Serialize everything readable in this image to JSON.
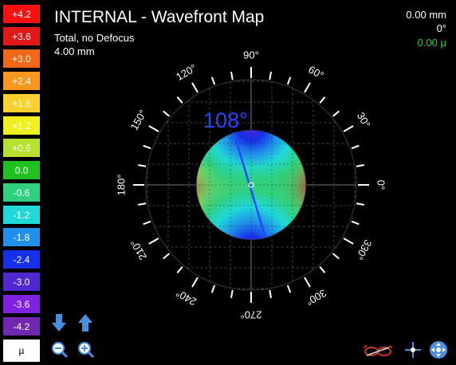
{
  "header": {
    "title": "INTERNAL - Wavefront Map",
    "subtitle": "Total, no Defocus",
    "zone": "4.00 mm"
  },
  "readout": {
    "distance": "0.00 mm",
    "angle": "0°",
    "value": "0.00 µ",
    "value_color": "#2bd12b"
  },
  "scale": {
    "steps": [
      {
        "label": "+4.2",
        "color": "#ff1010"
      },
      {
        "label": "+3.6",
        "color": "#e01818"
      },
      {
        "label": "+3.0",
        "color": "#f06818"
      },
      {
        "label": "+2.4",
        "color": "#f89820"
      },
      {
        "label": "+1.8",
        "color": "#f8d030"
      },
      {
        "label": "+1.2",
        "color": "#f0f020"
      },
      {
        "label": "+0.6",
        "color": "#b8e030"
      },
      {
        "label": "0.0",
        "color": "#20c020"
      },
      {
        "label": "-0.6",
        "color": "#30d080"
      },
      {
        "label": "-1.2",
        "color": "#20d8d8"
      },
      {
        "label": "-1.8",
        "color": "#2090e8"
      },
      {
        "label": "-2.4",
        "color": "#1830e8"
      },
      {
        "label": "-3.0",
        "color": "#5028d0"
      },
      {
        "label": "-3.6",
        "color": "#8020e0"
      },
      {
        "label": "-4.2",
        "color": "#7028b0"
      }
    ],
    "unit": "µ"
  },
  "axis": {
    "angle_label": "108°",
    "angle_color": "#2448ff",
    "degree_labels": [
      "0°",
      "30°",
      "60°",
      "90°",
      "120°",
      "150°",
      "180°",
      "210°",
      "240°",
      "270°",
      "300°",
      "330°"
    ]
  },
  "controls": {
    "scroll_down_icon": "arrow-down-icon",
    "scroll_up_icon": "arrow-up-icon",
    "zoom_out_icon": "zoom-out-icon",
    "zoom_in_icon": "zoom-in-icon",
    "glasses_icon": "glasses-icon",
    "crosshair_icon": "crosshair-icon",
    "move_icon": "move-icon"
  }
}
